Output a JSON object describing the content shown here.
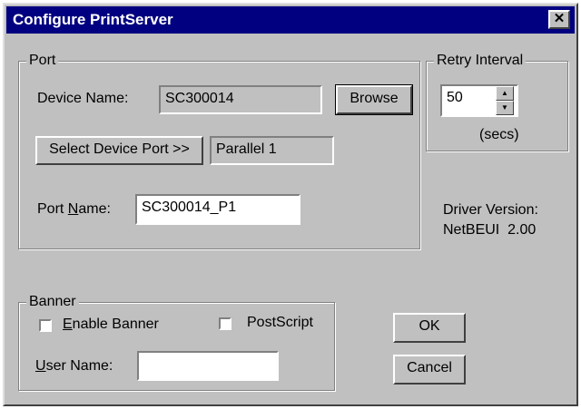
{
  "window": {
    "title": "Configure PrintServer",
    "close_glyph": "✕"
  },
  "port_group": {
    "legend": "Port",
    "device_name_label": "Device Name:",
    "device_name_value": "SC300014",
    "browse_label": "Browse",
    "select_port_label": "Select Device Port >>",
    "selected_port_value": "Parallel 1",
    "port_name_label_pre": "Port ",
    "port_name_label_u": "N",
    "port_name_label_post": "ame:",
    "port_name_value": "SC300014_P1"
  },
  "retry_group": {
    "legend": "Retry Interval",
    "value": "50",
    "unit": "(secs)",
    "up_glyph": "▲",
    "down_glyph": "▼"
  },
  "driver": {
    "label": "Driver Version:",
    "value": "NetBEUI  2.00"
  },
  "banner_group": {
    "legend": "Banner",
    "enable_u": "E",
    "enable_rest": "nable Banner",
    "enable_checked": false,
    "postscript_label": "PostScript",
    "postscript_checked": false,
    "user_u": "U",
    "user_rest": "ser Name:",
    "user_value": ""
  },
  "buttons": {
    "ok": "OK",
    "cancel": "Cancel"
  }
}
